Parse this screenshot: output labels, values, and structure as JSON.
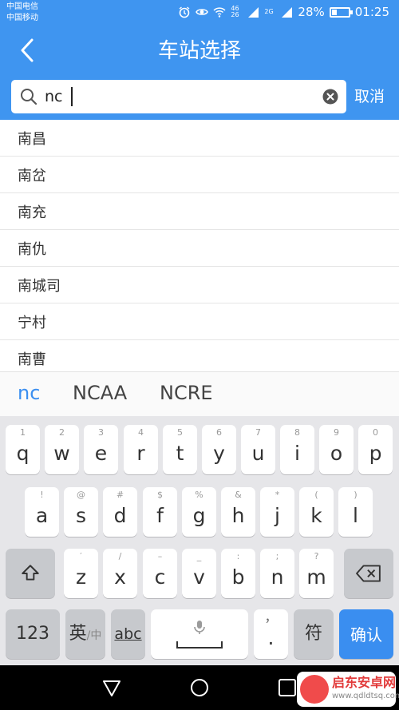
{
  "status_bar": {
    "carrier_1": "中国电信",
    "carrier_2": "中国移动",
    "network_1": "46 26",
    "network_2": "2G",
    "battery_text": "28%",
    "battery_level": 0.28,
    "time": "01:25"
  },
  "header": {
    "title": "车站选择",
    "search": {
      "value": "nc",
      "placeholder": ""
    },
    "cancel_label": "取消"
  },
  "stations": [
    "南昌",
    "南岔",
    "南充",
    "南仇",
    "南城司",
    "宁村",
    "南曹"
  ],
  "candidates": [
    "nc",
    "NCAA",
    "NCRE"
  ],
  "keyboard": {
    "row1": [
      {
        "main": "q",
        "sub": "1"
      },
      {
        "main": "w",
        "sub": "2"
      },
      {
        "main": "e",
        "sub": "3"
      },
      {
        "main": "r",
        "sub": "4"
      },
      {
        "main": "t",
        "sub": "5"
      },
      {
        "main": "y",
        "sub": "6"
      },
      {
        "main": "u",
        "sub": "7"
      },
      {
        "main": "i",
        "sub": "8"
      },
      {
        "main": "o",
        "sub": "9"
      },
      {
        "main": "p",
        "sub": "0"
      }
    ],
    "row2": [
      {
        "main": "a",
        "sub": "!"
      },
      {
        "main": "s",
        "sub": "@"
      },
      {
        "main": "d",
        "sub": "#"
      },
      {
        "main": "f",
        "sub": "$"
      },
      {
        "main": "g",
        "sub": "%"
      },
      {
        "main": "h",
        "sub": "&"
      },
      {
        "main": "j",
        "sub": "*"
      },
      {
        "main": "k",
        "sub": "("
      },
      {
        "main": "l",
        "sub": ")"
      }
    ],
    "row3": [
      {
        "main": "z",
        "sub": "′"
      },
      {
        "main": "x",
        "sub": "/"
      },
      {
        "main": "c",
        "sub": "–"
      },
      {
        "main": "v",
        "sub": "_"
      },
      {
        "main": "b",
        "sub": ":"
      },
      {
        "main": "n",
        "sub": ";"
      },
      {
        "main": "m",
        "sub": "?"
      }
    ],
    "num_label": "123",
    "lang_label": "英",
    "lang_sub": "/中",
    "abc_label": "abc",
    "comma_label": "，",
    "period_label": ".",
    "symbol_label": "符",
    "enter_label": "确认"
  },
  "watermark": {
    "title": "启东安卓网",
    "url": "www.qdldtsq.com"
  },
  "colors": {
    "header_blue": "#3f95f0",
    "enter_blue": "#3a8ef0",
    "candidate_active": "#3a8ef0"
  }
}
